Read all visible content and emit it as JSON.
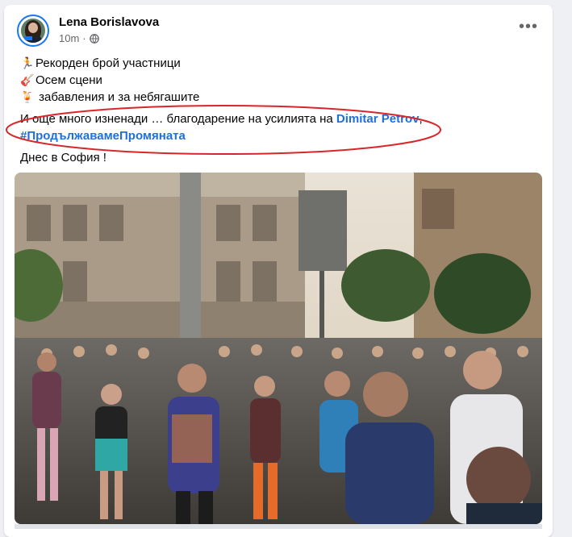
{
  "post": {
    "author": "Lena Borislavova",
    "time": "10m",
    "separator": "·",
    "privacy_icon": "globe-icon",
    "more_icon": "more-options-icon",
    "more_label": "•••",
    "lines": [
      {
        "icon": "runner-emoji",
        "glyph": "🏃",
        "text": "Рекорден брой участници"
      },
      {
        "icon": "guitar-emoji",
        "glyph": "🎸",
        "text": "Осем сцени"
      },
      {
        "icon": "drink-emoji",
        "glyph": "🍹",
        "text": " забавления и за небягашите"
      }
    ],
    "thanks_text": "И още много изненади … благодарение на усилията на ",
    "mention": "Dimitar Petrov",
    "comma": ",",
    "hashtag": "#ПродължавамеПромяната",
    "closing": "Днес в София !"
  },
  "colors": {
    "link": "#216fdb",
    "annotation": "#d9262a",
    "secondary_text": "#65676b"
  },
  "photo": {
    "subject": "marathon-runners-crowd-photo"
  }
}
